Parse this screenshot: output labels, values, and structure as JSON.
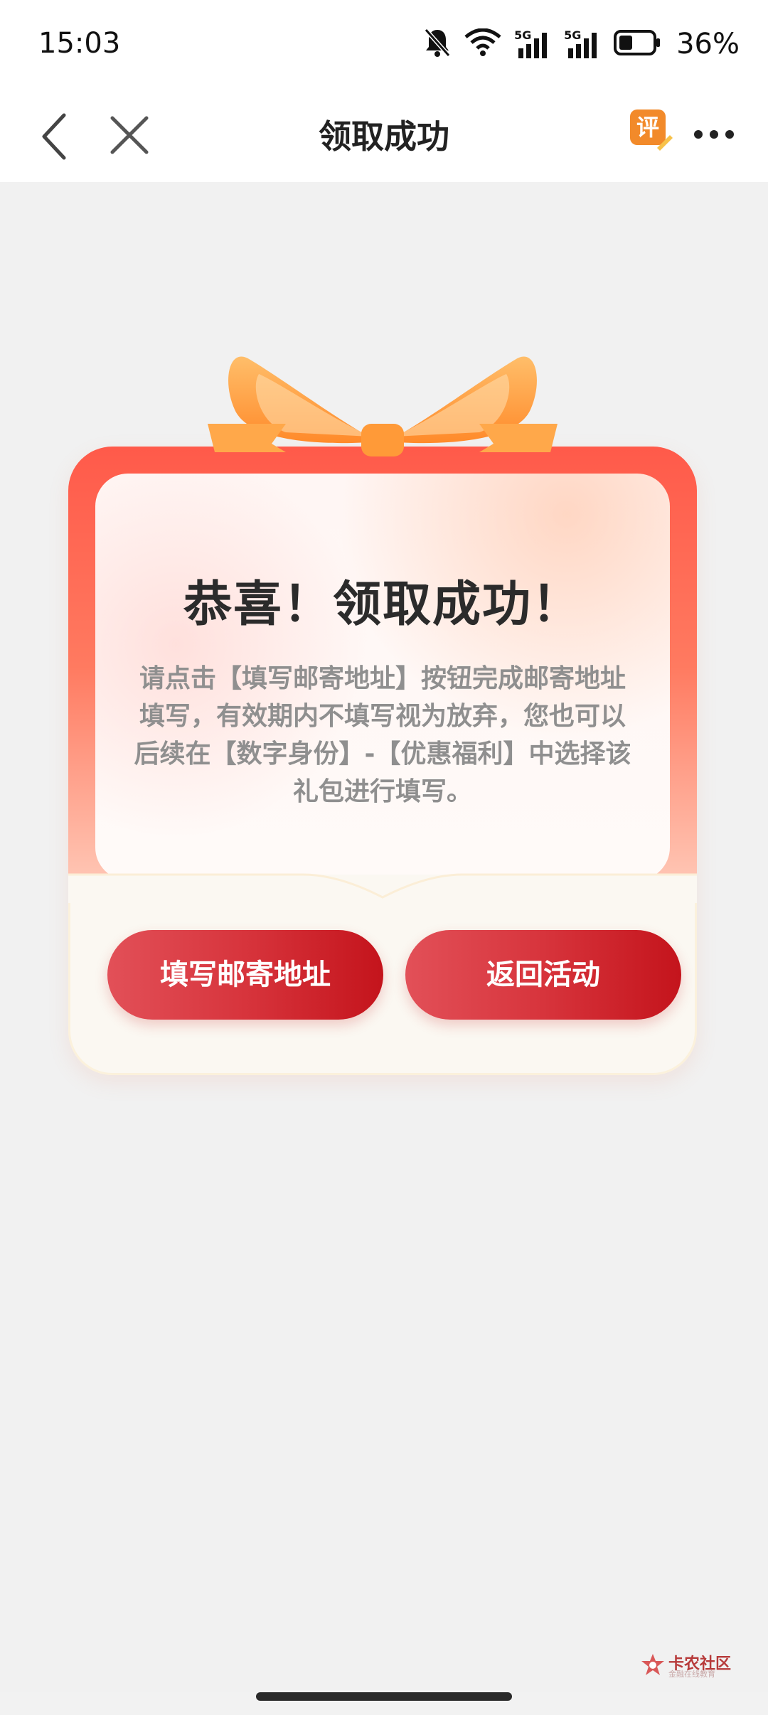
{
  "status_bar": {
    "time": "15:03",
    "network_1": "5G",
    "network_2": "5G",
    "battery_percent": "36%",
    "icons": [
      "bell-muted-icon",
      "wifi-icon",
      "signal-icon",
      "signal-icon",
      "battery-icon"
    ]
  },
  "navbar": {
    "title": "领取成功",
    "review_icon_char": "评",
    "icons": [
      "back-icon",
      "close-icon",
      "review-icon",
      "more-icon"
    ]
  },
  "card": {
    "title": "恭喜！领取成功！",
    "description": "请点击【填写邮寄地址】按钮完成邮寄地址填写，有效期内不填写视为放弃，您也可以后续在【数字身份】-【优惠福利】中选择该礼包进行填写。",
    "buttons": {
      "fill_address": "填写邮寄地址",
      "back_to_activity": "返回活动"
    }
  },
  "watermark": {
    "name": "卡农社区",
    "tagline": "金融在线教育"
  },
  "colors": {
    "accent_red": "#d7343c",
    "frame_red": "#ff5a4a",
    "ribbon_orange": "#ff9a3a",
    "background": "#f1f1f1"
  }
}
